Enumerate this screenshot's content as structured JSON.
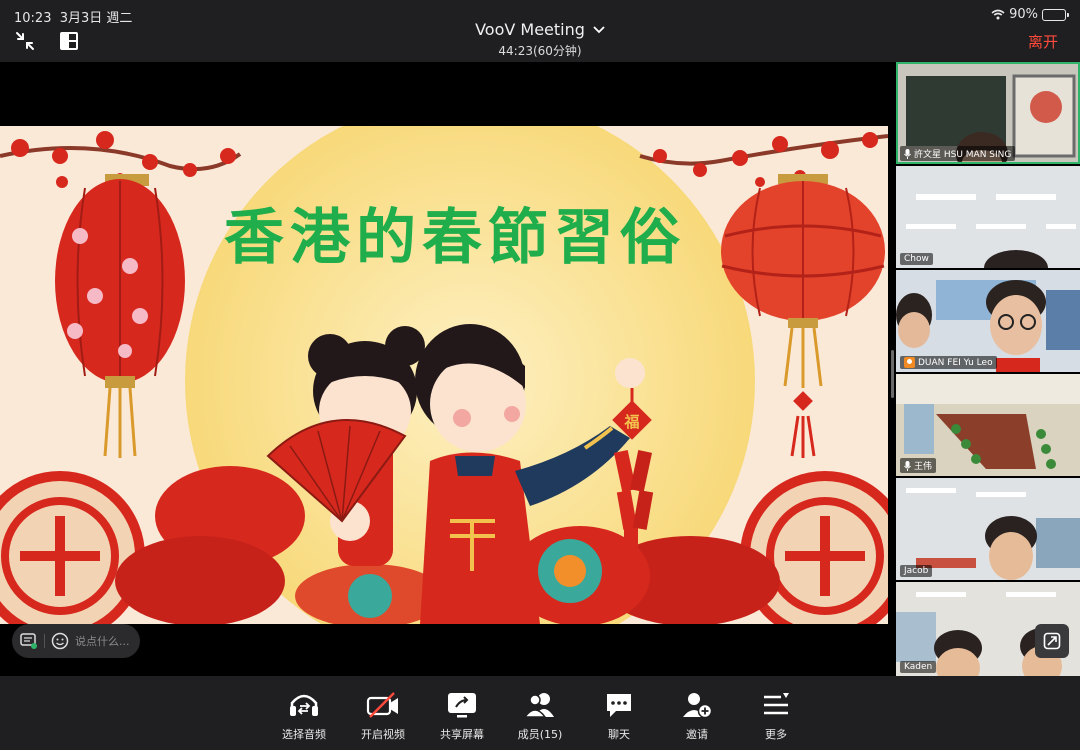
{
  "status_bar": {
    "time": "10:23",
    "date": "3月3日 週二",
    "battery": "90%",
    "battery_level": 0.9
  },
  "header": {
    "app_title": "VooV Meeting",
    "timer": "44:23(60分钟)",
    "leave_label": "离开"
  },
  "slide": {
    "title": "香港的春節習俗",
    "lantern_char": "福",
    "accent_colors": {
      "red": "#d7281e",
      "green": "#1fae4b",
      "navy": "#1f3a5c",
      "teal": "#3aa89a",
      "sun": "#fbe7a7"
    }
  },
  "chat": {
    "placeholder": "说点什么..."
  },
  "participants": [
    {
      "name": "許文星 HSU MAN SING",
      "mic": true,
      "host": false,
      "active": true
    },
    {
      "name": "Chow",
      "mic": false,
      "host": false,
      "active": false
    },
    {
      "name": "DUAN FEI Yu Leo",
      "mic": false,
      "host": true,
      "active": false
    },
    {
      "name": "王伟",
      "mic": true,
      "host": false,
      "active": false
    },
    {
      "name": "Jacob",
      "mic": false,
      "host": false,
      "active": false
    },
    {
      "name": "Kaden",
      "mic": false,
      "host": false,
      "active": false
    }
  ],
  "toolbar": {
    "audio": "选择音频",
    "video": "开启视频",
    "share": "共享屏幕",
    "members": "成员(15)",
    "chat": "聊天",
    "invite": "邀请",
    "more": "更多"
  },
  "icons": [
    "shrink-icon",
    "layout-icon",
    "chevron-down-icon",
    "wifi-icon",
    "battery-icon",
    "chat-log-icon",
    "emoji-icon",
    "mic-icon",
    "host-icon",
    "floating-window-icon",
    "audio-icon",
    "video-off-icon",
    "share-screen-icon",
    "members-icon",
    "chat-icon",
    "invite-icon",
    "more-icon"
  ]
}
